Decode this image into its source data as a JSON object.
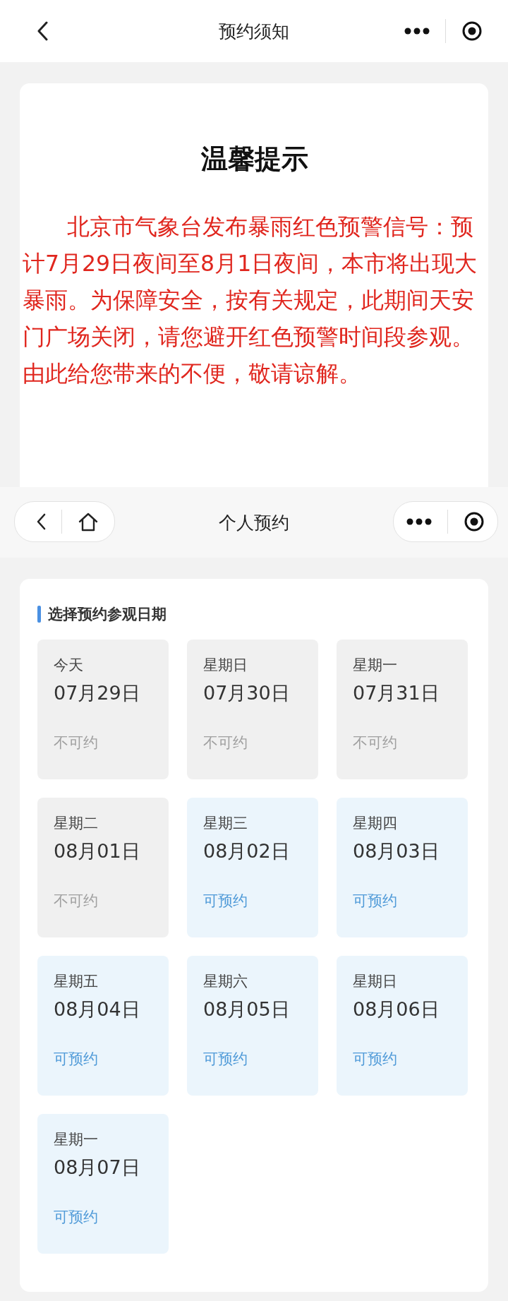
{
  "top_nav": {
    "title": "预约须知"
  },
  "notice": {
    "title": "温馨提示",
    "text": "北京市气象台发布暴雨红色预警信号：预计7月29日夜间至8月1日夜间，本市将出现大暴雨。为保障安全，按有关规定，此期间天安门广场关闭，请您避开红色预警时间段参观。由此给您带来的不便，敬请谅解。"
  },
  "booking_nav": {
    "title": "个人预约"
  },
  "section_title": "选择预约参观日期",
  "dates": [
    {
      "weekday": "今天",
      "date": "07月29日",
      "status": "不可约",
      "available": false
    },
    {
      "weekday": "星期日",
      "date": "07月30日",
      "status": "不可约",
      "available": false
    },
    {
      "weekday": "星期一",
      "date": "07月31日",
      "status": "不可约",
      "available": false
    },
    {
      "weekday": "星期二",
      "date": "08月01日",
      "status": "不可约",
      "available": false
    },
    {
      "weekday": "星期三",
      "date": "08月02日",
      "status": "可预约",
      "available": true
    },
    {
      "weekday": "星期四",
      "date": "08月03日",
      "status": "可预约",
      "available": true
    },
    {
      "weekday": "星期五",
      "date": "08月04日",
      "status": "可预约",
      "available": true
    },
    {
      "weekday": "星期六",
      "date": "08月05日",
      "status": "可预约",
      "available": true
    },
    {
      "weekday": "星期日",
      "date": "08月06日",
      "status": "可预约",
      "available": true
    },
    {
      "weekday": "星期一",
      "date": "08月07日",
      "status": "可预约",
      "available": true
    }
  ]
}
